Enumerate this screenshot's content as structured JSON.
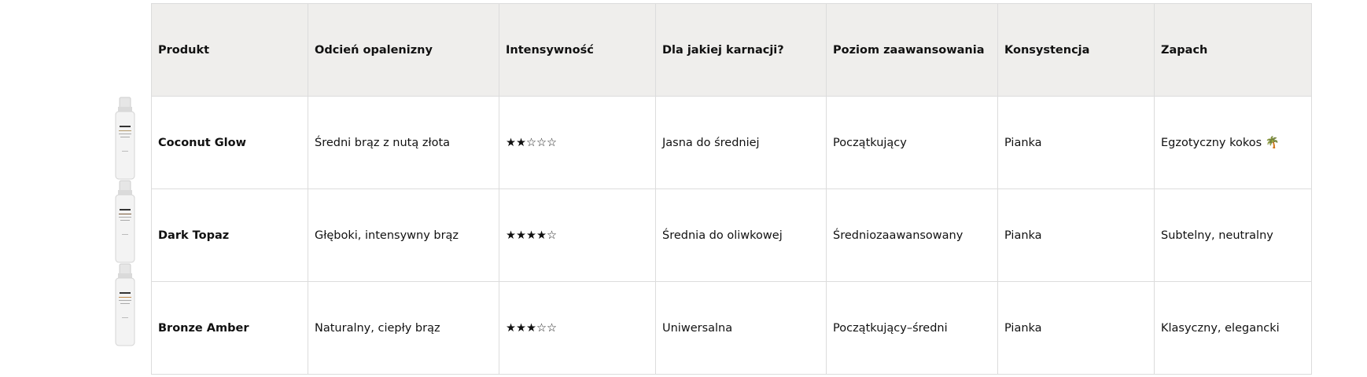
{
  "table": {
    "headers": [
      "Produkt",
      "Odcień opalenizny",
      "Intensywność",
      "Dla jakiej karnacji?",
      "Poziom zaawansowania",
      "Konsystencja",
      "Zapach"
    ],
    "rows": [
      {
        "product": "Coconut Glow",
        "shade": "Średni brąz z nutą złota",
        "intensity": "★★☆☆☆",
        "intensity_value": 2,
        "intensity_max": 5,
        "skin": "Jasna do średniej",
        "level": "Początkujący",
        "texture": "Pianka",
        "scent": "Egzotyczny kokos 🌴",
        "thumbnail_icon": "foam-bottle-icon"
      },
      {
        "product": "Dark Topaz",
        "shade": "Głęboki, intensywny brąz",
        "intensity": "★★★★☆",
        "intensity_value": 4,
        "intensity_max": 5,
        "skin": "Średnia do oliwkowej",
        "level": "Średniozaawansowany",
        "texture": "Pianka",
        "scent": "Subtelny, neutralny",
        "thumbnail_icon": "foam-bottle-icon"
      },
      {
        "product": "Bronze Amber",
        "shade": "Naturalny, ciepły brąz",
        "intensity": "★★★☆☆",
        "intensity_value": 3,
        "intensity_max": 5,
        "skin": "Uniwersalna",
        "level": "Początkujący–średni",
        "texture": "Pianka",
        "scent": "Klasyczny, elegancki",
        "thumbnail_icon": "foam-bottle-icon"
      }
    ]
  },
  "colors": {
    "header_bg": "#efeeec",
    "border": "#dcdcdc",
    "text": "#111111"
  }
}
